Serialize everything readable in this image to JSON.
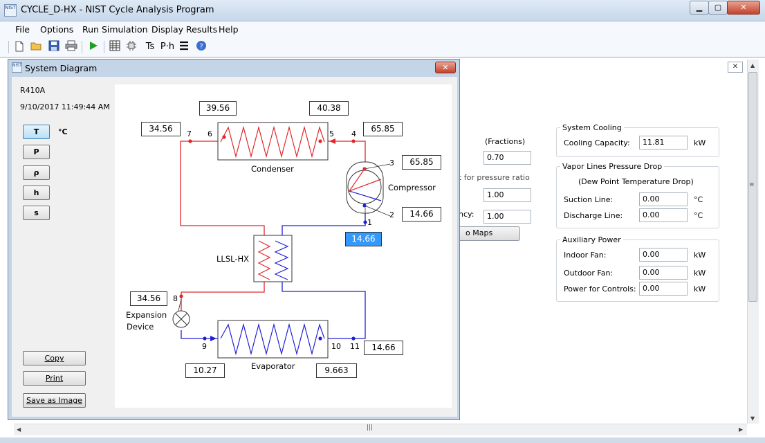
{
  "window": {
    "title": "CYCLE_D-HX - NIST Cycle Analysis Program",
    "icon_text": "NIST"
  },
  "window_controls": {
    "minimize": "▁",
    "maximize": "▢",
    "close": "✕"
  },
  "menu": [
    "File",
    "Options",
    "Run Simulation",
    "Display Results",
    "Help"
  ],
  "toolbar_icons": [
    "new-file-icon",
    "open-folder-icon",
    "save-icon",
    "print-icon",
    "run-icon",
    "table-icon",
    "chip-icon",
    "ts-diagram",
    "ph-diagram",
    "lines-icon",
    "help-icon"
  ],
  "toolbar_text": {
    "ts": "Ts",
    "ph": "P·h"
  },
  "background": {
    "close": "✕",
    "fractions_label": "(Fractions)",
    "fraction_value": "0.70",
    "pressure_ratio_label": "t for pressure ratio",
    "value_a": "1.00",
    "efficiency_label": "ncy:",
    "value_b": "1.00",
    "maps_button": "o Maps",
    "system_cooling": {
      "title": "System Cooling",
      "label": "Cooling Capacity:",
      "value": "11.81",
      "unit": "kW"
    },
    "vapor_lines": {
      "title": "Vapor Lines Pressure Drop",
      "subtitle": "(Dew Point Temperature Drop)",
      "suction_label": "Suction Line:",
      "suction_value": "0.00",
      "suction_unit": "°C",
      "discharge_label": "Discharge Line:",
      "discharge_value": "0.00",
      "discharge_unit": "°C"
    },
    "aux_power": {
      "title": "Auxiliary Power",
      "indoor_label": "Indoor Fan:",
      "indoor_value": "0.00",
      "indoor_unit": "kW",
      "outdoor_label": "Outdoor Fan:",
      "outdoor_value": "0.00",
      "outdoor_unit": "kW",
      "controls_label": "Power for Controls:",
      "controls_value": "0.00",
      "controls_unit": "kW"
    }
  },
  "system_diagram": {
    "title": "System Diagram",
    "close": "✕",
    "refrigerant": "R410A",
    "timestamp": "9/10/2017 11:49:44 AM",
    "property_buttons": [
      "T",
      "P",
      "ρ",
      "h",
      "s"
    ],
    "unit": "°C",
    "copy": "Copy",
    "print": "Print",
    "save_image": "Save as Image",
    "labels": {
      "condenser": "Condenser",
      "compressor": "Compressor",
      "llsl": "LLSL-HX",
      "expansion1": "Expansion",
      "expansion2": "Device",
      "evaporator": "Evaporator"
    },
    "values": {
      "cond_in": "39.56",
      "cond_out": "40.38",
      "p7": "34.56",
      "p4": "65.85",
      "p3": "65.85",
      "p2": "14.66",
      "p1": "14.66",
      "p8": "34.56",
      "p11": "14.66",
      "p9": "10.27",
      "p10": "9.663"
    },
    "points": [
      "1",
      "2",
      "3",
      "4",
      "5",
      "6",
      "7",
      "8",
      "9",
      "10",
      "11"
    ],
    "colors": {
      "hot": "#e0262a",
      "cold": "#2020d8"
    }
  }
}
